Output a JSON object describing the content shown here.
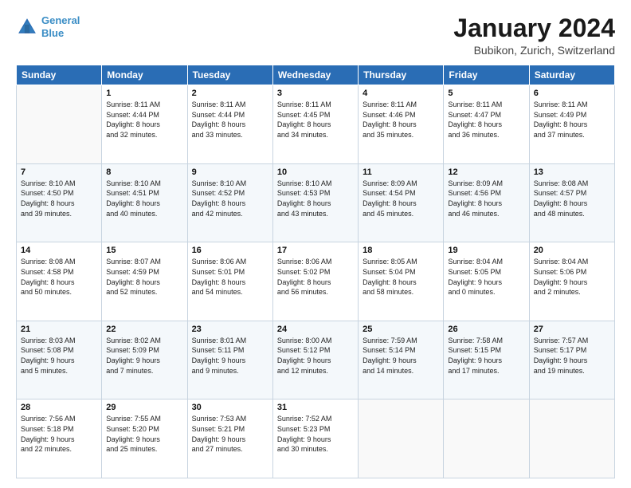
{
  "header": {
    "logo_line1": "General",
    "logo_line2": "Blue",
    "title": "January 2024",
    "subtitle": "Bubikon, Zurich, Switzerland"
  },
  "weekdays": [
    "Sunday",
    "Monday",
    "Tuesday",
    "Wednesday",
    "Thursday",
    "Friday",
    "Saturday"
  ],
  "weeks": [
    [
      {
        "day": "",
        "sunrise": "",
        "sunset": "",
        "daylight": ""
      },
      {
        "day": "1",
        "sunrise": "Sunrise: 8:11 AM",
        "sunset": "Sunset: 4:44 PM",
        "daylight": "Daylight: 8 hours and 32 minutes."
      },
      {
        "day": "2",
        "sunrise": "Sunrise: 8:11 AM",
        "sunset": "Sunset: 4:44 PM",
        "daylight": "Daylight: 8 hours and 33 minutes."
      },
      {
        "day": "3",
        "sunrise": "Sunrise: 8:11 AM",
        "sunset": "Sunset: 4:45 PM",
        "daylight": "Daylight: 8 hours and 34 minutes."
      },
      {
        "day": "4",
        "sunrise": "Sunrise: 8:11 AM",
        "sunset": "Sunset: 4:46 PM",
        "daylight": "Daylight: 8 hours and 35 minutes."
      },
      {
        "day": "5",
        "sunrise": "Sunrise: 8:11 AM",
        "sunset": "Sunset: 4:47 PM",
        "daylight": "Daylight: 8 hours and 36 minutes."
      },
      {
        "day": "6",
        "sunrise": "Sunrise: 8:11 AM",
        "sunset": "Sunset: 4:49 PM",
        "daylight": "Daylight: 8 hours and 37 minutes."
      }
    ],
    [
      {
        "day": "7",
        "sunrise": "Sunrise: 8:10 AM",
        "sunset": "Sunset: 4:50 PM",
        "daylight": "Daylight: 8 hours and 39 minutes."
      },
      {
        "day": "8",
        "sunrise": "Sunrise: 8:10 AM",
        "sunset": "Sunset: 4:51 PM",
        "daylight": "Daylight: 8 hours and 40 minutes."
      },
      {
        "day": "9",
        "sunrise": "Sunrise: 8:10 AM",
        "sunset": "Sunset: 4:52 PM",
        "daylight": "Daylight: 8 hours and 42 minutes."
      },
      {
        "day": "10",
        "sunrise": "Sunrise: 8:10 AM",
        "sunset": "Sunset: 4:53 PM",
        "daylight": "Daylight: 8 hours and 43 minutes."
      },
      {
        "day": "11",
        "sunrise": "Sunrise: 8:09 AM",
        "sunset": "Sunset: 4:54 PM",
        "daylight": "Daylight: 8 hours and 45 minutes."
      },
      {
        "day": "12",
        "sunrise": "Sunrise: 8:09 AM",
        "sunset": "Sunset: 4:56 PM",
        "daylight": "Daylight: 8 hours and 46 minutes."
      },
      {
        "day": "13",
        "sunrise": "Sunrise: 8:08 AM",
        "sunset": "Sunset: 4:57 PM",
        "daylight": "Daylight: 8 hours and 48 minutes."
      }
    ],
    [
      {
        "day": "14",
        "sunrise": "Sunrise: 8:08 AM",
        "sunset": "Sunset: 4:58 PM",
        "daylight": "Daylight: 8 hours and 50 minutes."
      },
      {
        "day": "15",
        "sunrise": "Sunrise: 8:07 AM",
        "sunset": "Sunset: 4:59 PM",
        "daylight": "Daylight: 8 hours and 52 minutes."
      },
      {
        "day": "16",
        "sunrise": "Sunrise: 8:06 AM",
        "sunset": "Sunset: 5:01 PM",
        "daylight": "Daylight: 8 hours and 54 minutes."
      },
      {
        "day": "17",
        "sunrise": "Sunrise: 8:06 AM",
        "sunset": "Sunset: 5:02 PM",
        "daylight": "Daylight: 8 hours and 56 minutes."
      },
      {
        "day": "18",
        "sunrise": "Sunrise: 8:05 AM",
        "sunset": "Sunset: 5:04 PM",
        "daylight": "Daylight: 8 hours and 58 minutes."
      },
      {
        "day": "19",
        "sunrise": "Sunrise: 8:04 AM",
        "sunset": "Sunset: 5:05 PM",
        "daylight": "Daylight: 9 hours and 0 minutes."
      },
      {
        "day": "20",
        "sunrise": "Sunrise: 8:04 AM",
        "sunset": "Sunset: 5:06 PM",
        "daylight": "Daylight: 9 hours and 2 minutes."
      }
    ],
    [
      {
        "day": "21",
        "sunrise": "Sunrise: 8:03 AM",
        "sunset": "Sunset: 5:08 PM",
        "daylight": "Daylight: 9 hours and 5 minutes."
      },
      {
        "day": "22",
        "sunrise": "Sunrise: 8:02 AM",
        "sunset": "Sunset: 5:09 PM",
        "daylight": "Daylight: 9 hours and 7 minutes."
      },
      {
        "day": "23",
        "sunrise": "Sunrise: 8:01 AM",
        "sunset": "Sunset: 5:11 PM",
        "daylight": "Daylight: 9 hours and 9 minutes."
      },
      {
        "day": "24",
        "sunrise": "Sunrise: 8:00 AM",
        "sunset": "Sunset: 5:12 PM",
        "daylight": "Daylight: 9 hours and 12 minutes."
      },
      {
        "day": "25",
        "sunrise": "Sunrise: 7:59 AM",
        "sunset": "Sunset: 5:14 PM",
        "daylight": "Daylight: 9 hours and 14 minutes."
      },
      {
        "day": "26",
        "sunrise": "Sunrise: 7:58 AM",
        "sunset": "Sunset: 5:15 PM",
        "daylight": "Daylight: 9 hours and 17 minutes."
      },
      {
        "day": "27",
        "sunrise": "Sunrise: 7:57 AM",
        "sunset": "Sunset: 5:17 PM",
        "daylight": "Daylight: 9 hours and 19 minutes."
      }
    ],
    [
      {
        "day": "28",
        "sunrise": "Sunrise: 7:56 AM",
        "sunset": "Sunset: 5:18 PM",
        "daylight": "Daylight: 9 hours and 22 minutes."
      },
      {
        "day": "29",
        "sunrise": "Sunrise: 7:55 AM",
        "sunset": "Sunset: 5:20 PM",
        "daylight": "Daylight: 9 hours and 25 minutes."
      },
      {
        "day": "30",
        "sunrise": "Sunrise: 7:53 AM",
        "sunset": "Sunset: 5:21 PM",
        "daylight": "Daylight: 9 hours and 27 minutes."
      },
      {
        "day": "31",
        "sunrise": "Sunrise: 7:52 AM",
        "sunset": "Sunset: 5:23 PM",
        "daylight": "Daylight: 9 hours and 30 minutes."
      },
      {
        "day": "",
        "sunrise": "",
        "sunset": "",
        "daylight": ""
      },
      {
        "day": "",
        "sunrise": "",
        "sunset": "",
        "daylight": ""
      },
      {
        "day": "",
        "sunrise": "",
        "sunset": "",
        "daylight": ""
      }
    ]
  ]
}
